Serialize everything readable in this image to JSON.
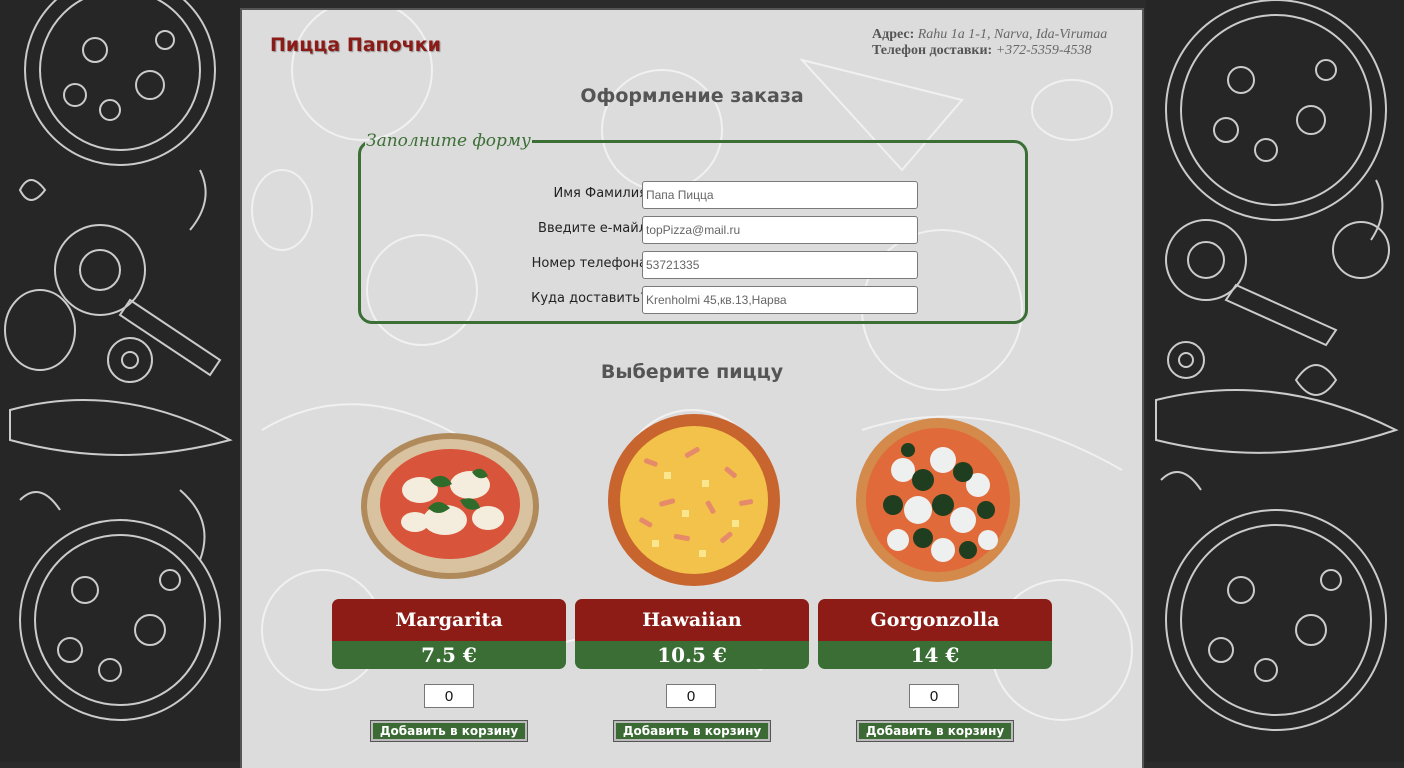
{
  "header": {
    "brand": "Пицца Папочки",
    "address_label": "Адрес:",
    "address_value": "Rahu 1a 1-1, Narva, Ida-Virumaa",
    "phone_label": "Телефон доставки:",
    "phone_value": "+372-5359-4538"
  },
  "order_title": "Оформление заказа",
  "form": {
    "legend": "Заполните форму",
    "fields": [
      {
        "label": "Имя Фамилия",
        "placeholder": "Папа Пицца"
      },
      {
        "label": "Введите е-майл",
        "placeholder": "topPizza@mail.ru"
      },
      {
        "label": "Номер телефона",
        "placeholder": "53721335"
      },
      {
        "label": "Куда доставить?",
        "placeholder": "Krenholmi 45,кв.13,Нарва"
      }
    ]
  },
  "choose_title": "Выберите пиццу",
  "pizzas": [
    {
      "name": "Margarita",
      "price": "7.5 €",
      "qty": "0",
      "button": "Добавить в корзину",
      "image": "margarita-pizza"
    },
    {
      "name": "Hawaiian",
      "price": "10.5 €",
      "qty": "0",
      "button": "Добавить в корзину",
      "image": "hawaiian-pizza"
    },
    {
      "name": "Gorgonzolla",
      "price": "14 €",
      "qty": "0",
      "button": "Добавить в корзину",
      "image": "gorgonzola-pizza"
    }
  ],
  "colors": {
    "brand_red": "#8a1b17",
    "card_red": "#8c1c15",
    "card_green": "#3a6e35",
    "form_green": "#3c6f36",
    "page_bg": "#dcdcdc",
    "side_bg": "#262626"
  }
}
